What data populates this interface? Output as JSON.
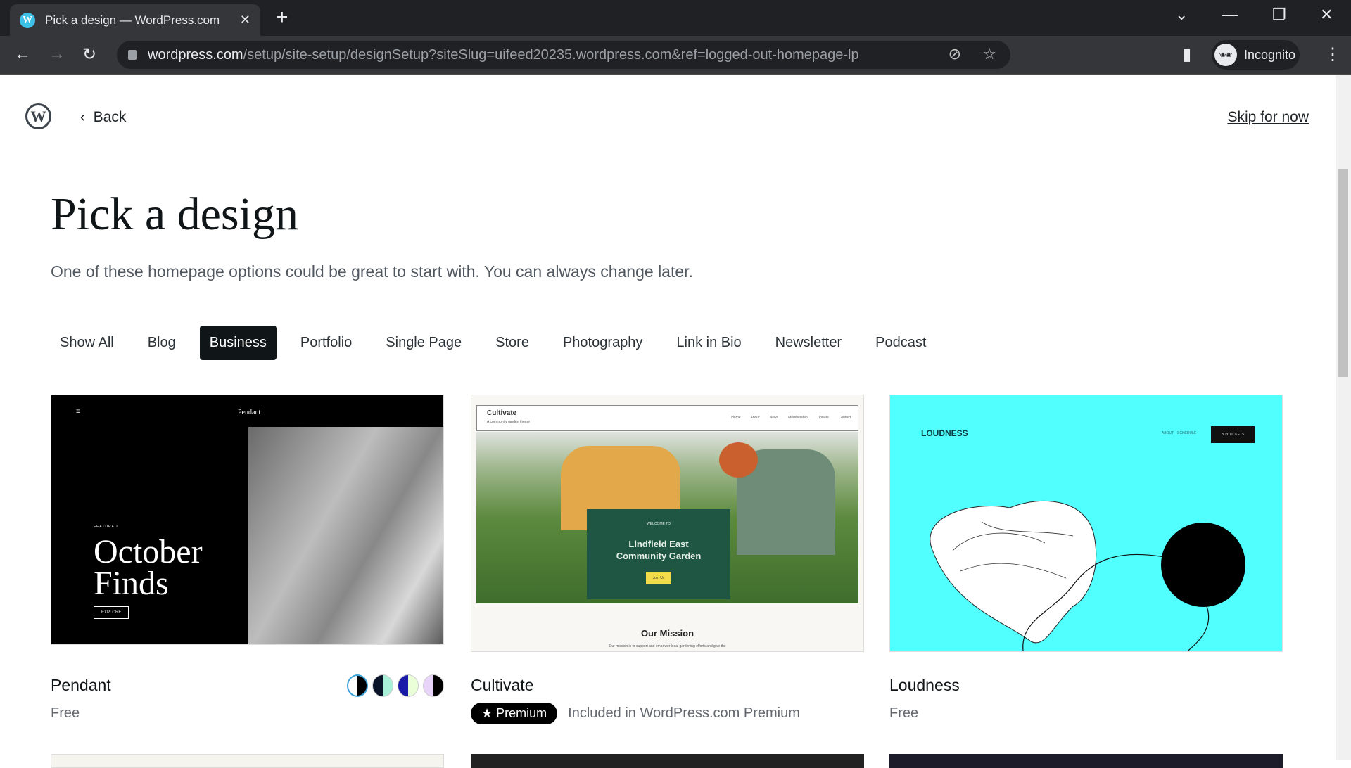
{
  "browser": {
    "tab_title": "Pick a design — WordPress.com",
    "url_host": "wordpress.com",
    "url_path": "/setup/site-setup/designSetup?siteSlug=uifeed20235.wordpress.com&ref=logged-out-homepage-lp",
    "profile": "Incognito"
  },
  "header": {
    "back": "Back",
    "skip": "Skip for now"
  },
  "title": "Pick a design",
  "subtitle": "One of these homepage options could be great to start with. You can always change later.",
  "filters": [
    "Show All",
    "Blog",
    "Business",
    "Portfolio",
    "Single Page",
    "Store",
    "Photography",
    "Link in Bio",
    "Newsletter",
    "Podcast"
  ],
  "active_filter": "Business",
  "designs": [
    {
      "name": "Pendant",
      "price": "Free",
      "preview": {
        "site": "Pendant",
        "kicker": "FEATURED",
        "headline1": "October",
        "headline2": "Finds",
        "button": "EXPLORE"
      },
      "swatches": [
        [
          "#ffffff",
          "#000000"
        ],
        [
          "#0a1428",
          "#a8f0d8"
        ],
        [
          "#1a1aa8",
          "#eaffd8"
        ],
        [
          "#e8d4f8",
          "#000000"
        ]
      ]
    },
    {
      "name": "Cultivate",
      "badge": "Premium",
      "note": "Included in WordPress.com Premium",
      "preview": {
        "site": "Cultivate",
        "tagline": "A community garden theme",
        "menu": [
          "Home",
          "About",
          "News",
          "Membership",
          "Donate",
          "Contact"
        ],
        "kicker": "WELCOME TO",
        "headline": "Lindfield East Community Garden",
        "button": "Join Us",
        "section": "Our Mission",
        "body": "Our mission is to support and empower local gardening efforts and give the"
      }
    },
    {
      "name": "Loudness",
      "price": "Free",
      "preview": {
        "site": "LOUDNESS",
        "menu": [
          "ABOUT",
          "SCHEDULE"
        ],
        "button": "BUY TICKETS"
      },
      "accent": "#52ffff"
    }
  ]
}
